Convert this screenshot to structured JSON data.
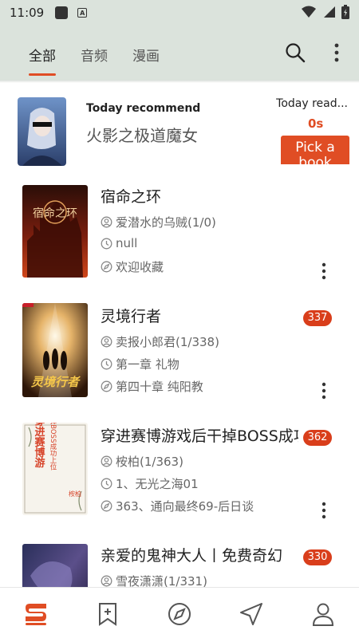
{
  "status_bar": {
    "time": "11:09",
    "notification_icon": "a-icon"
  },
  "tabs": [
    {
      "label": "全部",
      "active": true
    },
    {
      "label": "音频"
    },
    {
      "label": "漫画"
    }
  ],
  "recommend": {
    "label": "Today recommend",
    "title": "火影之极道魔女",
    "read_label": "Today read...",
    "read_value": "0s",
    "pick_button": "Pick a book"
  },
  "books": [
    {
      "title": "宿命之环",
      "author": "爱潜水的乌贼(1/0)",
      "latest": "null",
      "last_read": "欢迎收藏",
      "badge": ""
    },
    {
      "title": "灵境行者",
      "author": "卖报小郎君(1/338)",
      "latest": "第一章 礼物",
      "last_read": "第四十章 纯阳教",
      "badge": "337"
    },
    {
      "title": "穿进赛博游戏后干掉BOSS成功上位",
      "author": "桉柏(1/363)",
      "latest": "1、无光之海01",
      "last_read": "363、通向最终69-后日谈",
      "badge": "362"
    },
    {
      "title": "亲爱的鬼神大人丨免费奇幻",
      "author": "雪夜潇潇(1/331)",
      "latest": "",
      "last_read": "",
      "badge": "330"
    }
  ],
  "covers": [
    {
      "text": "宿命之环"
    },
    {
      "text": "灵境行者"
    },
    {
      "text": "穿进赛博游戏后干掉BOSS成功上位",
      "author": "桉柏"
    }
  ],
  "colors": {
    "accent": "#e04d24",
    "badge": "#d93e1b",
    "header_bg": "#dbe3dc"
  }
}
